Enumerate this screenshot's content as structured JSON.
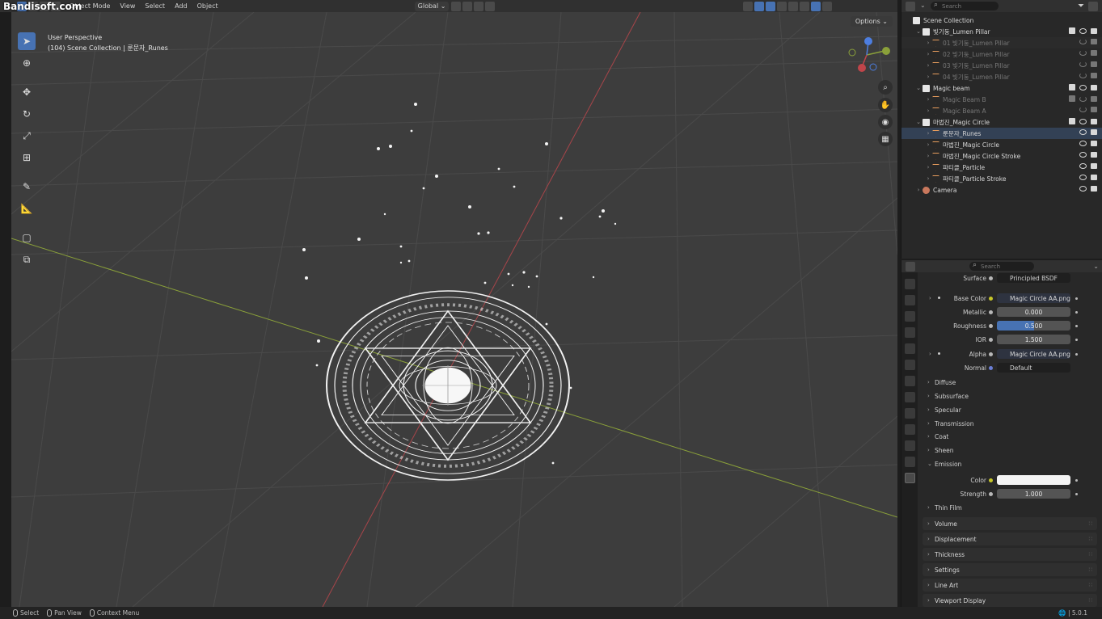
{
  "watermark": "Bandisoft.com",
  "viewport_header": {
    "mode": "Object Mode",
    "menus": [
      "View",
      "Select",
      "Add",
      "Object"
    ],
    "transform_orientation": "Global"
  },
  "viewport": {
    "perspective_label": "User Perspective",
    "context_label": "(104) Scene Collection | 룬문자_Runes",
    "options_label": "Options"
  },
  "outliner": {
    "search_placeholder": "Search",
    "rows": [
      {
        "label": "Scene Collection",
        "type": "coll",
        "indent": 0,
        "arrow": "",
        "style": "",
        "check": false,
        "eye": false,
        "cam": false
      },
      {
        "label": "빛기둥_Lumen Pillar",
        "type": "coll",
        "indent": 1,
        "arrow": "⌄",
        "style": "",
        "check": true,
        "eye": true,
        "cam": true
      },
      {
        "label": "01 빛기둥_Lumen Pillar",
        "type": "mesh",
        "indent": 2,
        "arrow": "›",
        "style": "dim alt",
        "check": false,
        "eye": "closed",
        "cam": true
      },
      {
        "label": "02 빛기둥_Lumen Pillar",
        "type": "mesh",
        "indent": 2,
        "arrow": "›",
        "style": "dim",
        "check": false,
        "eye": "closed",
        "cam": true
      },
      {
        "label": "03 빛기둥_Lumen Pillar",
        "type": "mesh",
        "indent": 2,
        "arrow": "›",
        "style": "dim",
        "check": false,
        "eye": "closed",
        "cam": true
      },
      {
        "label": "04 빛기둥_Lumen Pillar",
        "type": "mesh",
        "indent": 2,
        "arrow": "›",
        "style": "dim",
        "check": false,
        "eye": "closed",
        "cam": true
      },
      {
        "label": "Magic beam",
        "type": "coll",
        "indent": 1,
        "arrow": "⌄",
        "style": "",
        "check": true,
        "eye": true,
        "cam": true
      },
      {
        "label": "Magic Beam B",
        "type": "mesh",
        "indent": 2,
        "arrow": "›",
        "style": "dim",
        "check": true,
        "eye": "closed",
        "cam": true
      },
      {
        "label": "Magic Beam A",
        "type": "mesh",
        "indent": 2,
        "arrow": "›",
        "style": "dim",
        "check": false,
        "eye": "closed",
        "cam": true
      },
      {
        "label": "마법진_Magic Circle",
        "type": "coll",
        "indent": 1,
        "arrow": "⌄",
        "style": "",
        "check": true,
        "eye": true,
        "cam": true
      },
      {
        "label": "룬문자_Runes",
        "type": "mesh",
        "indent": 2,
        "arrow": "›",
        "style": "sel",
        "check": false,
        "eye": true,
        "cam": true
      },
      {
        "label": "마법진_Magic Circle",
        "type": "mesh",
        "indent": 2,
        "arrow": "›",
        "style": "",
        "check": false,
        "eye": true,
        "cam": true
      },
      {
        "label": "마법진_Magic Circle Stroke",
        "type": "mesh",
        "indent": 2,
        "arrow": "›",
        "style": "",
        "check": false,
        "eye": true,
        "cam": true
      },
      {
        "label": "파티클_Particle",
        "type": "mesh",
        "indent": 2,
        "arrow": "›",
        "style": "",
        "check": false,
        "eye": true,
        "cam": true
      },
      {
        "label": "파티클_Particle Stroke",
        "type": "mesh",
        "indent": 2,
        "arrow": "›",
        "style": "",
        "check": false,
        "eye": true,
        "cam": true
      },
      {
        "label": "Camera",
        "type": "cam",
        "indent": 1,
        "arrow": "›",
        "style": "",
        "check": false,
        "eye": true,
        "cam": true
      }
    ]
  },
  "properties": {
    "search_placeholder": "Search",
    "surface": {
      "label": "Surface",
      "value": "Principled BSDF"
    },
    "base_color": {
      "label": "Base Color",
      "value": "Magic Circle AA.png"
    },
    "metallic": {
      "label": "Metallic",
      "value": "0.000"
    },
    "roughness": {
      "label": "Roughness",
      "value": "0.500",
      "fraction": 0.5
    },
    "ior": {
      "label": "IOR",
      "value": "1.500"
    },
    "alpha": {
      "label": "Alpha",
      "value": "Magic Circle AA.png"
    },
    "normal": {
      "label": "Normal",
      "value": "Default"
    },
    "subsections": [
      "Diffuse",
      "Subsurface",
      "Specular",
      "Transmission",
      "Coat",
      "Sheen"
    ],
    "emission": {
      "label": "Emission",
      "color_label": "Color",
      "strength_label": "Strength",
      "strength": "1.000",
      "color": "#f4f4f4"
    },
    "thin_film": "Thin Film",
    "panels": [
      "Volume",
      "Displacement",
      "Thickness",
      "Settings",
      "Line Art",
      "Viewport Display"
    ]
  },
  "statusbar": {
    "select": "Select",
    "pan": "Pan View",
    "context": "Context Menu",
    "version": "5.0.1"
  },
  "colors": {
    "accent": "#4772b3",
    "viewport_bg": "#3d3d3d",
    "x_axis": "#a8454a",
    "y_axis": "#8aa03a"
  }
}
